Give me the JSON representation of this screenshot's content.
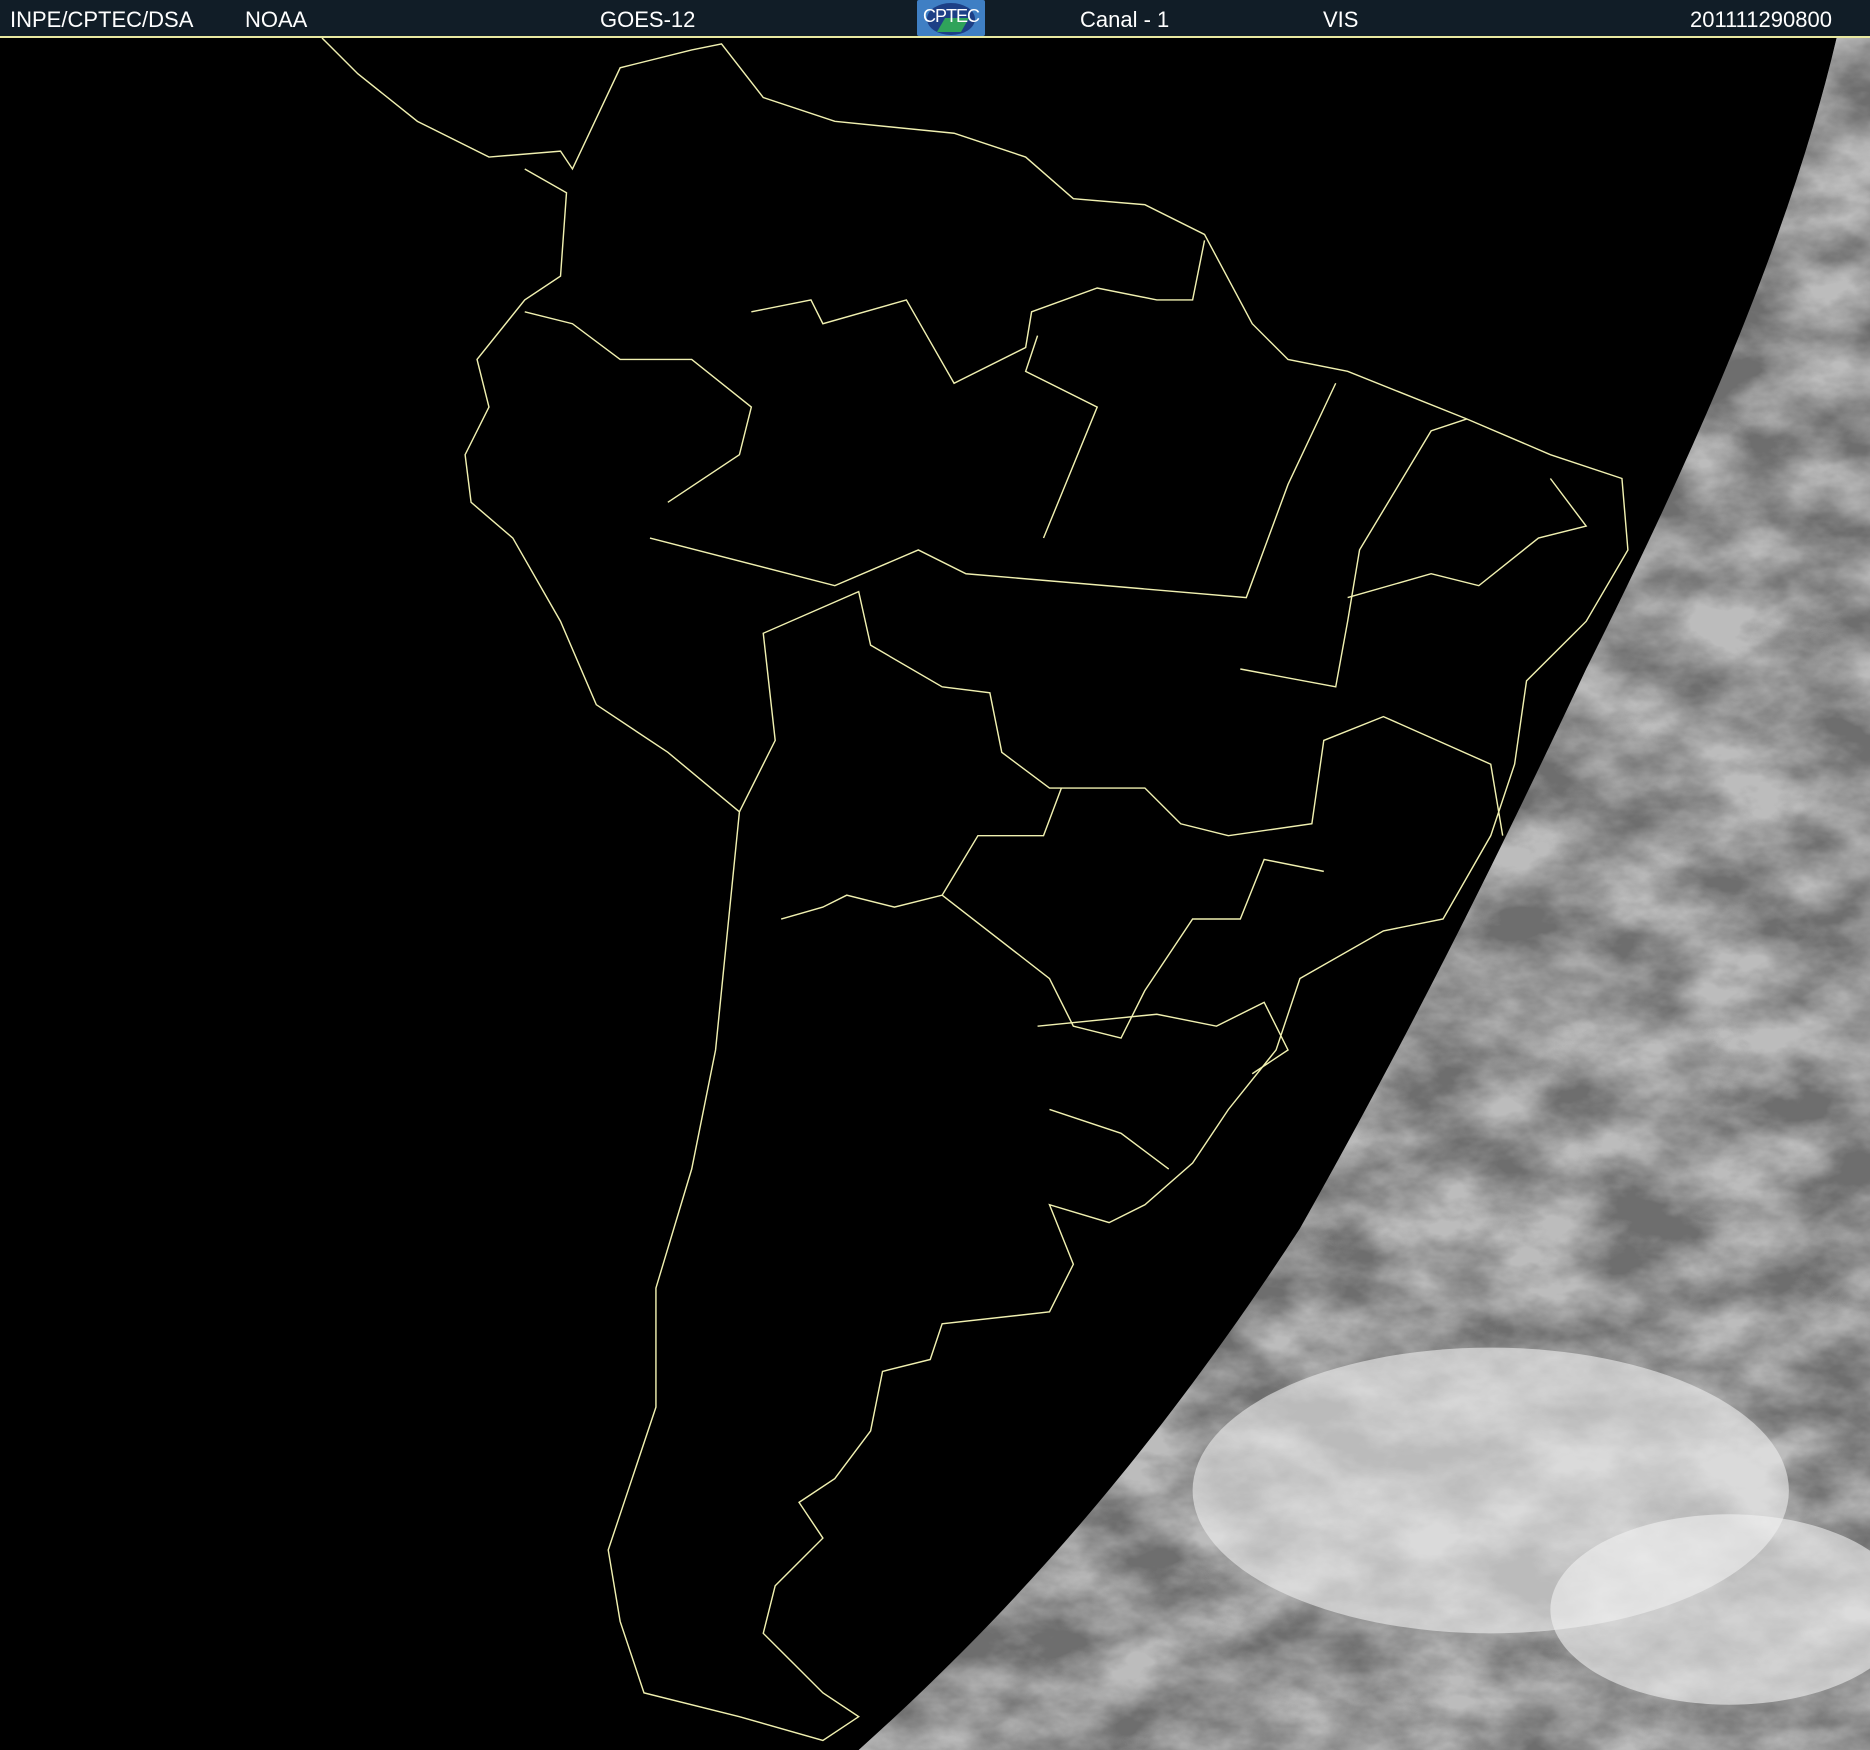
{
  "header": {
    "source": "INPE/CPTEC/DSA",
    "agency": "NOAA",
    "satellite": "GOES-12",
    "logo_text": "CPTEC",
    "channel": "Canal - 1",
    "band": "VIS",
    "timestamp": "201111290800"
  },
  "colors": {
    "header_bg": "#111d27",
    "border_lines": "#f0f0b0",
    "space": "#000000"
  }
}
